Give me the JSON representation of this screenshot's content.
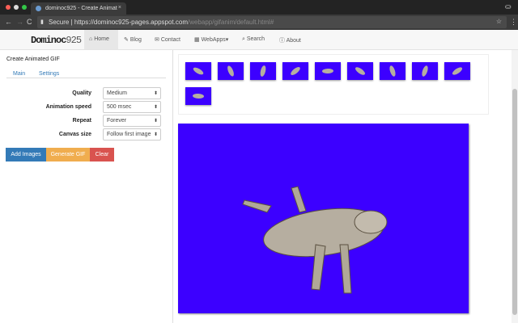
{
  "browser": {
    "tab_title": "dominoc925 - Create Animat",
    "secure_label": "Secure",
    "url_host": "https://dominoc925-pages.appspot.com",
    "url_path": "/webapp/gifanim/default.html#"
  },
  "navbar": {
    "logo_main": "Dominoc",
    "logo_num": "925",
    "items": [
      {
        "label": "Home",
        "icon": "home-icon"
      },
      {
        "label": "Blog",
        "icon": "pencil-icon"
      },
      {
        "label": "Contact",
        "icon": "envelope-icon"
      },
      {
        "label": "WebApps▾",
        "icon": "grid-icon"
      },
      {
        "label": "Search",
        "icon": "search-icon"
      },
      {
        "label": "About",
        "icon": "info-icon"
      }
    ]
  },
  "panel": {
    "title": "Create Animated GIF",
    "tabs": [
      "Main",
      "Settings"
    ],
    "settings": [
      {
        "label": "Quality",
        "value": "Medium"
      },
      {
        "label": "Animation speed",
        "value": "500 msec"
      },
      {
        "label": "Repeat",
        "value": "Forever"
      },
      {
        "label": "Canvas size",
        "value": "Follow first image"
      }
    ],
    "buttons": {
      "add": "Add Images",
      "generate": "Generate GIF",
      "clear": "Clear"
    }
  },
  "colors": {
    "frame_bg": "#3c00ff",
    "add": "#337ab7",
    "generate": "#f0ad4e",
    "clear": "#d9534f"
  },
  "frames_count": 10
}
